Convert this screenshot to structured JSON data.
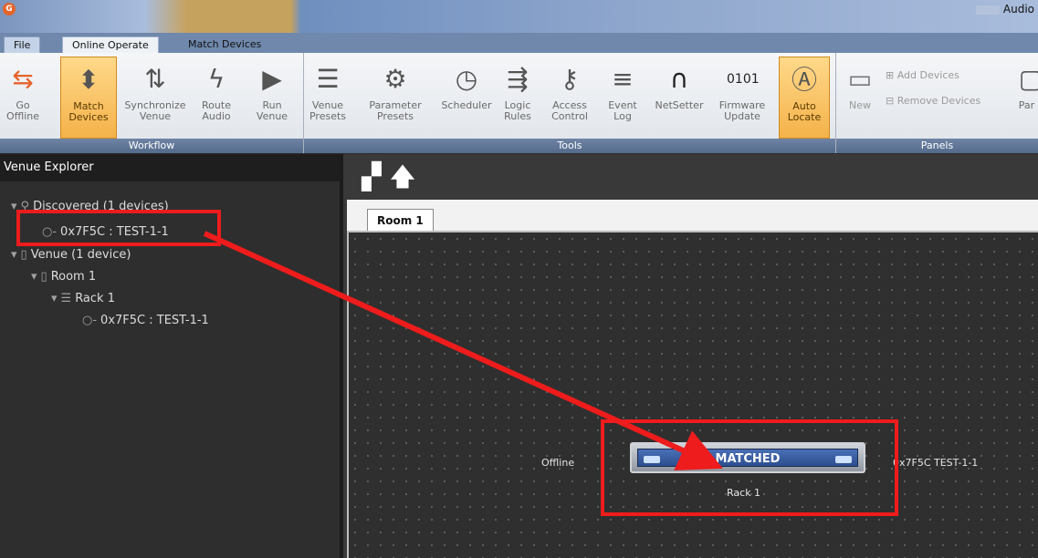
{
  "window": {
    "title": "Audio"
  },
  "tabs": [
    {
      "label": "File"
    },
    {
      "label": "Online Operate"
    },
    {
      "label": "Match Devices"
    }
  ],
  "ribbon": {
    "workflow": {
      "label": "Workflow",
      "buttons": [
        {
          "line1": "Go",
          "line2": "Offline"
        },
        {
          "line1": "Match",
          "line2": "Devices"
        },
        {
          "line1": "Synchronize",
          "line2": "Venue"
        },
        {
          "line1": "Route",
          "line2": "Audio"
        },
        {
          "line1": "Run",
          "line2": "Venue"
        }
      ]
    },
    "tools": {
      "label": "Tools",
      "buttons": [
        {
          "line1": "Venue",
          "line2": "Presets"
        },
        {
          "line1": "Parameter",
          "line2": "Presets"
        },
        {
          "line1": "Scheduler",
          "line2": ""
        },
        {
          "line1": "Logic",
          "line2": "Rules"
        },
        {
          "line1": "Access",
          "line2": "Control"
        },
        {
          "line1": "Event",
          "line2": "Log"
        },
        {
          "line1": "NetSetter",
          "line2": ""
        },
        {
          "line1": "Firmware",
          "line2": "Update"
        },
        {
          "line1": "Auto",
          "line2": "Locate"
        }
      ]
    },
    "panels": {
      "label": "Panels",
      "new": "New",
      "add_devices": "Add Devices",
      "remove_devices": "Remove Devices",
      "partial": "Par"
    }
  },
  "explorer": {
    "title": "Venue Explorer",
    "discovered": "Discovered (1 devices)",
    "discovered_device": "0x7F5C : TEST-1-1",
    "venue": "Venue (1 device)",
    "room": "Room 1",
    "rack": "Rack 1",
    "rack_device": "0x7F5C : TEST-1-1"
  },
  "canvas": {
    "room_tab": "Room 1",
    "status": "Offline",
    "device_text": "MATCHED",
    "rack_label": "Rack 1",
    "device_id": "0x7F5C  TEST-1-1"
  }
}
